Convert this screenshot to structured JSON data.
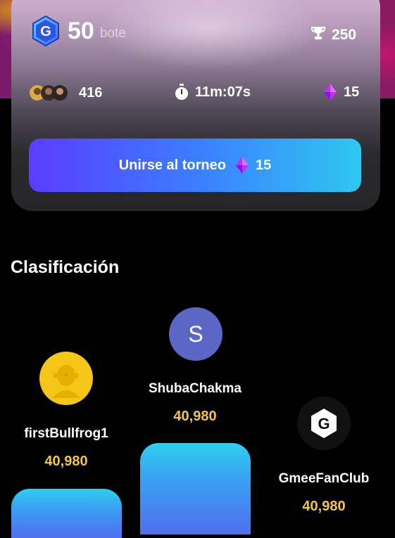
{
  "tournament": {
    "pot_value": "50",
    "pot_unit": "bote",
    "trophy_value": "250",
    "players_count": "416",
    "timer": "11m:07s",
    "entry_cost": "15",
    "join_button_label": "Unirse al torneo",
    "join_button_cost": "15"
  },
  "leaderboard": {
    "title": "Clasificación",
    "entries": [
      {
        "rank": 1,
        "name": "ShubaChakma",
        "score": "40,980",
        "avatar_letter": "S",
        "avatar_color": "#5a67c4"
      },
      {
        "rank": 2,
        "name": "firstBullfrog1",
        "score": "40,980",
        "avatar_color": "#f5c518"
      },
      {
        "rank": 3,
        "name": "GmeeFanClub",
        "score": "40,980",
        "avatar_letter": "G",
        "avatar_color": "#111111"
      }
    ]
  },
  "icons": [
    "g-token-icon",
    "trophy-icon",
    "player-avatars-icon",
    "stopwatch-icon",
    "gem-icon"
  ],
  "colors": {
    "accent_score": "#f3c545",
    "button_start": "#5b3cff",
    "button_end": "#2ec8f0",
    "gem": "#c02cff"
  }
}
